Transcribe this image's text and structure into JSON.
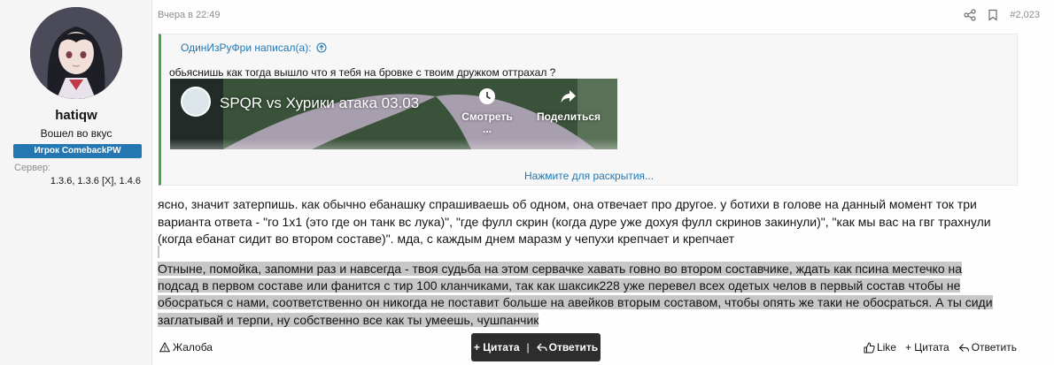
{
  "user": {
    "name": "hatiqw",
    "title": "Вошел во вкус",
    "banner": "Игрок ComebackPW",
    "extra_label": "Сервер:",
    "extra_value": "1.3.6, 1.3.6 [X], 1.4.6"
  },
  "post": {
    "date": "Вчера в 22:49",
    "number": "#2,023"
  },
  "quote": {
    "author_line": "ОдинИзРуФри написал(а):",
    "text": "обьяснишь как тогда вышло что я тебя на бровке с твоим дружком оттрахал ?",
    "video": {
      "title": "SPQR vs Хурики атака 03.03",
      "watch_later": "Смотреть ...",
      "share": "Поделиться"
    },
    "expand_label": "Нажмите для раскрытия..."
  },
  "message": {
    "paragraph1": "ясно, значит затерпишь. как обычно ебанашку спрашиваешь об одном, она отвечает про другое. у ботихи в голове на данный момент ток три варианта ответа - \"го 1х1 (это где он танк вс лука)\", \"где фулл скрин (когда дуре уже дохуя фулл скринов закинули)\", \"как мы вас на гвг трахнули (когда ебанат сидит во втором составе)\". мда, с каждым днем маразм у чепухи крепчает и крепчает",
    "paragraph2_lines": [
      "Отныне, помойка, запомни раз и навсегда - твоя судьба на этом сервачке хавать говно во втором составчике, ждать как псина местечко на",
      "подсад в первом составе или фанится с тир 100 кланчиками, так как шаксик228 уже перевел всех одетых челов в первый состав чтобы не",
      "обосраться с нами, соответственно он никогда не поставит больше на авейков вторым составом, чтобы опять же таки не обосраться. А ты сиди",
      "заглатывай и терпи, ну собственно все как ты умеешь, чушпанчик"
    ]
  },
  "footer": {
    "report": "Жалоба",
    "popup_quote": "+ Цитата",
    "popup_separator": "|",
    "popup_reply": "Ответить",
    "like": "Like",
    "quote": "+ Цитата",
    "reply": "Ответить"
  }
}
